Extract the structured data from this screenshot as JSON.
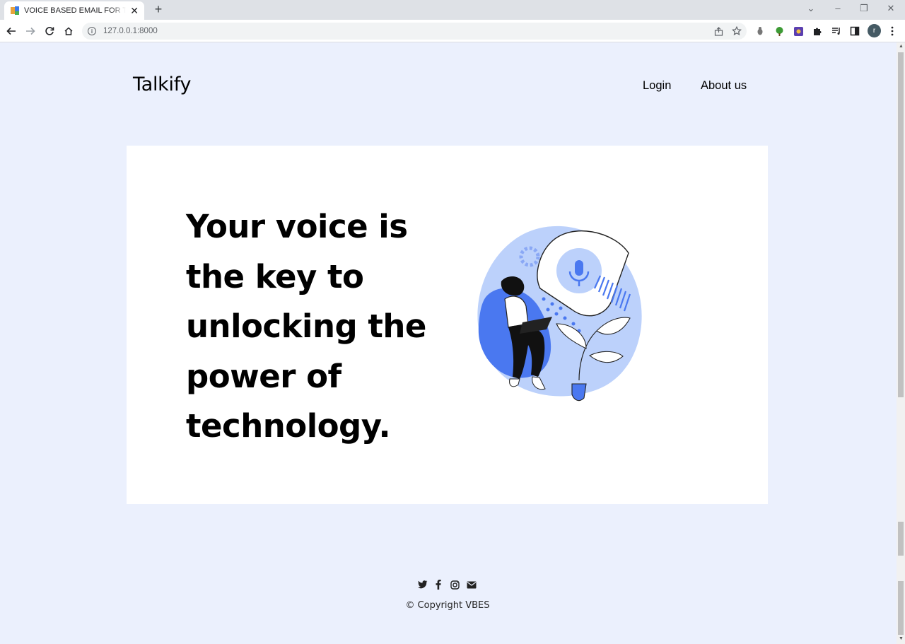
{
  "browser": {
    "tab_title": "VOICE BASED EMAIL FOR THE BLIND",
    "url": "127.0.0.1:8000",
    "profile_initial": "r"
  },
  "nav": {
    "brand": "Talkify",
    "links": [
      "Login",
      "About us"
    ]
  },
  "hero": {
    "heading_lines": [
      "Your voice is",
      "the key to",
      "unlocking the",
      "power of",
      "technology."
    ],
    "illustration": "person-with-laptop-and-microphone-illustration"
  },
  "footer": {
    "social_icons": [
      "twitter-icon",
      "facebook-icon",
      "instagram-icon",
      "email-icon"
    ],
    "copyright": "© Copyright VBES"
  },
  "colors": {
    "page_bg": "#ebf0fd",
    "card_bg": "#ffffff",
    "accent_blue": "#4a78f0",
    "light_blue": "#bcd1fb"
  }
}
